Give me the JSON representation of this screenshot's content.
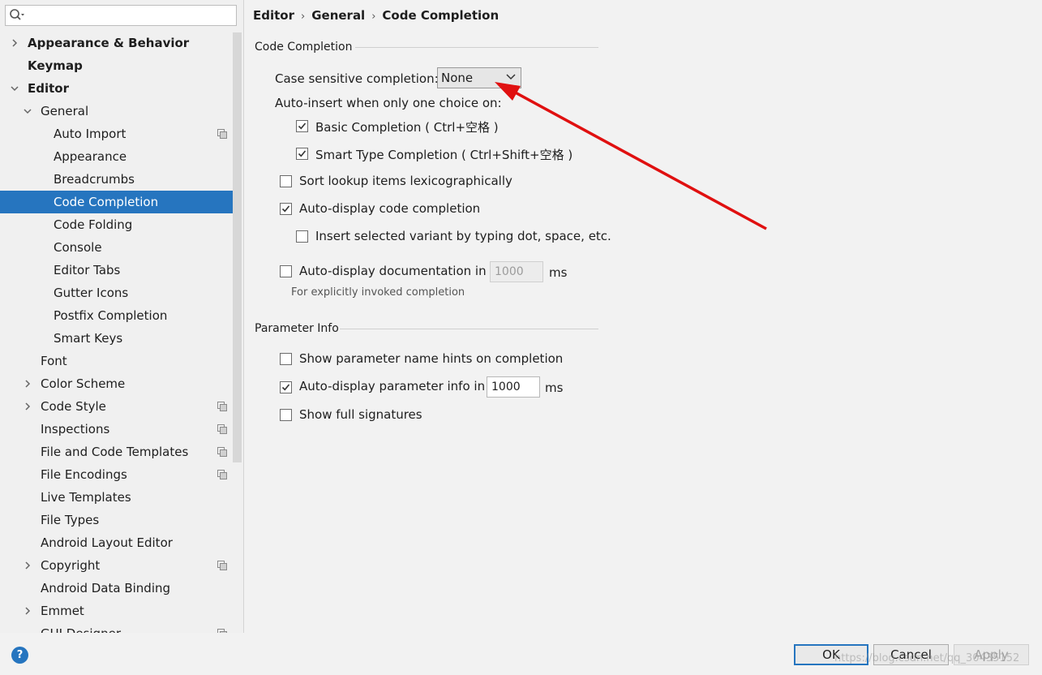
{
  "search": {
    "value": "",
    "placeholder": ""
  },
  "tree": [
    {
      "label": "Appearance & Behavior",
      "level": 0,
      "bold": true,
      "arrow": "right",
      "badge": false,
      "selected": false
    },
    {
      "label": "Keymap",
      "level": 0,
      "bold": true,
      "arrow": "none",
      "badge": false,
      "selected": false
    },
    {
      "label": "Editor",
      "level": 0,
      "bold": true,
      "arrow": "down",
      "badge": false,
      "selected": false
    },
    {
      "label": "General",
      "level": 1,
      "bold": false,
      "arrow": "down",
      "badge": false,
      "selected": false
    },
    {
      "label": "Auto Import",
      "level": 2,
      "bold": false,
      "arrow": "none",
      "badge": true,
      "selected": false
    },
    {
      "label": "Appearance",
      "level": 2,
      "bold": false,
      "arrow": "none",
      "badge": false,
      "selected": false
    },
    {
      "label": "Breadcrumbs",
      "level": 2,
      "bold": false,
      "arrow": "none",
      "badge": false,
      "selected": false
    },
    {
      "label": "Code Completion",
      "level": 2,
      "bold": false,
      "arrow": "none",
      "badge": false,
      "selected": true
    },
    {
      "label": "Code Folding",
      "level": 2,
      "bold": false,
      "arrow": "none",
      "badge": false,
      "selected": false
    },
    {
      "label": "Console",
      "level": 2,
      "bold": false,
      "arrow": "none",
      "badge": false,
      "selected": false
    },
    {
      "label": "Editor Tabs",
      "level": 2,
      "bold": false,
      "arrow": "none",
      "badge": false,
      "selected": false
    },
    {
      "label": "Gutter Icons",
      "level": 2,
      "bold": false,
      "arrow": "none",
      "badge": false,
      "selected": false
    },
    {
      "label": "Postfix Completion",
      "level": 2,
      "bold": false,
      "arrow": "none",
      "badge": false,
      "selected": false
    },
    {
      "label": "Smart Keys",
      "level": 2,
      "bold": false,
      "arrow": "none",
      "badge": false,
      "selected": false
    },
    {
      "label": "Font",
      "level": 1,
      "bold": false,
      "arrow": "none",
      "badge": false,
      "selected": false
    },
    {
      "label": "Color Scheme",
      "level": 1,
      "bold": false,
      "arrow": "right",
      "badge": false,
      "selected": false
    },
    {
      "label": "Code Style",
      "level": 1,
      "bold": false,
      "arrow": "right",
      "badge": true,
      "selected": false
    },
    {
      "label": "Inspections",
      "level": 1,
      "bold": false,
      "arrow": "none",
      "badge": true,
      "selected": false
    },
    {
      "label": "File and Code Templates",
      "level": 1,
      "bold": false,
      "arrow": "none",
      "badge": true,
      "selected": false
    },
    {
      "label": "File Encodings",
      "level": 1,
      "bold": false,
      "arrow": "none",
      "badge": true,
      "selected": false
    },
    {
      "label": "Live Templates",
      "level": 1,
      "bold": false,
      "arrow": "none",
      "badge": false,
      "selected": false
    },
    {
      "label": "File Types",
      "level": 1,
      "bold": false,
      "arrow": "none",
      "badge": false,
      "selected": false
    },
    {
      "label": "Android Layout Editor",
      "level": 1,
      "bold": false,
      "arrow": "none",
      "badge": false,
      "selected": false
    },
    {
      "label": "Copyright",
      "level": 1,
      "bold": false,
      "arrow": "right",
      "badge": true,
      "selected": false
    },
    {
      "label": "Android Data Binding",
      "level": 1,
      "bold": false,
      "arrow": "none",
      "badge": false,
      "selected": false
    },
    {
      "label": "Emmet",
      "level": 1,
      "bold": false,
      "arrow": "right",
      "badge": false,
      "selected": false
    },
    {
      "label": "GUI Designer",
      "level": 1,
      "bold": false,
      "arrow": "none",
      "badge": true,
      "selected": false
    }
  ],
  "breadcrumb": {
    "part1": "Editor",
    "part2": "General",
    "part3": "Code Completion"
  },
  "code_completion": {
    "section_title": "Code Completion",
    "case_label": "Case sensitive completion:",
    "case_value": "None",
    "autoinsert_label": "Auto-insert when only one choice on:",
    "basic_label": "Basic Completion ( Ctrl+空格 )",
    "basic_checked": true,
    "smart_label": "Smart Type Completion ( Ctrl+Shift+空格 )",
    "smart_checked": true,
    "sort_label": "Sort lookup items lexicographically",
    "sort_checked": false,
    "autodisplay_label": "Auto-display code completion",
    "autodisplay_checked": true,
    "insert_label": "Insert selected variant by typing dot, space, etc.",
    "insert_checked": false,
    "doc_label": "Auto-display documentation in",
    "doc_checked": false,
    "doc_value": "1000",
    "doc_unit": "ms",
    "doc_hint": "For explicitly invoked completion"
  },
  "parameter_info": {
    "section_title": "Parameter Info",
    "hints_label": "Show parameter name hints on completion",
    "hints_checked": false,
    "autodisplay_label": "Auto-display parameter info in",
    "autodisplay_checked": true,
    "autodisplay_value": "1000",
    "autodisplay_unit": "ms",
    "signatures_label": "Show full signatures",
    "signatures_checked": false
  },
  "footer": {
    "help": "?",
    "ok": "OK",
    "cancel": "Cancel",
    "apply": "Apply",
    "watermark": "https://blog.csdn.net/qq_30435152"
  },
  "colors": {
    "selection": "#2675bf",
    "annotation_arrow": "#e01010"
  }
}
